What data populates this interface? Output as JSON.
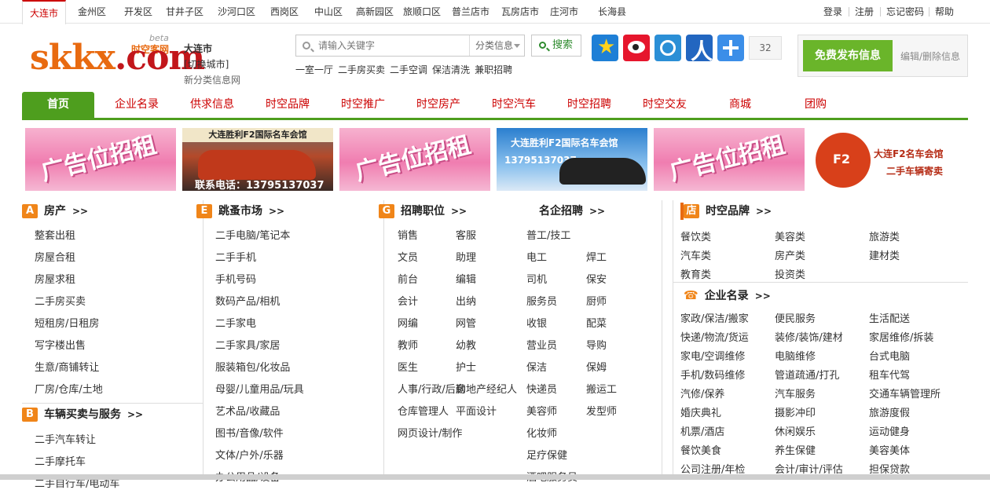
{
  "topbar": {
    "cities": [
      "大连市",
      "金州区",
      "开发区",
      "甘井子区",
      "沙河口区",
      "西岗区",
      "中山区",
      "高新园区",
      "旅顺口区",
      "普兰店市",
      "瓦房店市",
      "庄河市",
      "长海县"
    ],
    "account": [
      "登录",
      "注册",
      "忘记密码",
      "帮助"
    ]
  },
  "logo": {
    "main": "skkx",
    "dotcom": ".com",
    "beta": "beta",
    "brand": "时空客网"
  },
  "citybox": {
    "name": "大连市",
    "switch": "[切换城市]",
    "sub": "新分类信息网"
  },
  "search": {
    "placeholder": "请输入关键字",
    "category": "分类信息",
    "button": "搜索"
  },
  "hotwords": [
    "一室一厅",
    "二手房买卖",
    "二手空调",
    "保洁清洗",
    "兼职招聘"
  ],
  "social": [
    {
      "icon": "star-icon",
      "color": "#1e7fd6"
    },
    {
      "icon": "weibo-icon",
      "color": "#e6162d"
    },
    {
      "icon": "tencent-weibo-icon",
      "color": "#2b8fd6"
    },
    {
      "icon": "renren-icon",
      "color": "#2266c0"
    },
    {
      "icon": "plus-share-icon",
      "color": "#3b8ee8"
    }
  ],
  "share_count": "32",
  "post": {
    "button": "免费发布信息",
    "edit": "编辑/删除信息"
  },
  "nav": [
    "首页",
    "企业名录",
    "供求信息",
    "时空品牌",
    "时空推广",
    "时空房产",
    "时空汽车",
    "时空招聘",
    "时空交友",
    "商城",
    "团购"
  ],
  "banners": {
    "ad": "广告位招租",
    "car1_title": "大连胜利F2国际名车会馆",
    "car1_phone": "联系电话：13795137037",
    "car2_title": "大连胜利F2国际名车会馆",
    "car2_phone": "13795137037",
    "f2_title": "大连F2名车会馆",
    "f2_sub": "二手车辆寄卖"
  },
  "sections": {
    "house": {
      "letter": "A",
      "title": "房产",
      "arrow": ">>",
      "items": [
        "整套出租",
        "房屋合租",
        "房屋求租",
        "二手房买卖",
        "短租房/日租房",
        "写字楼出售",
        "生意/商铺转让",
        "厂房/仓库/土地"
      ]
    },
    "vehicle": {
      "letter": "B",
      "title": "车辆买卖与服务",
      "arrow": ">>",
      "items": [
        "二手汽车转让",
        "二手摩托车",
        "二手自行车/电动车"
      ]
    },
    "market": {
      "letter": "E",
      "title": "跳蚤市场",
      "arrow": ">>",
      "items": [
        "二手电脑/笔记本",
        "二手手机",
        "手机号码",
        "数码产品/相机",
        "二手家电",
        "二手家具/家居",
        "服装箱包/化妆品",
        "母婴/儿童用品/玩具",
        "艺术品/收藏品",
        "图书/音像/软件",
        "文体/户外/乐器",
        "办公用品/设备"
      ]
    },
    "jobs": {
      "letter": "G",
      "title": "招聘职位",
      "arrow": ">>",
      "items": [
        "销售",
        "客服",
        "文员",
        "助理",
        "前台",
        "编辑",
        "会计",
        "出纳",
        "网编",
        "网管",
        "教师",
        "幼教",
        "医生",
        "护士",
        "人事/行政/后勤",
        "房地产经纪人",
        "仓库管理人",
        "平面设计",
        "网页设计/制作"
      ]
    },
    "famous": {
      "title": "名企招聘",
      "arrow": ">>",
      "items": [
        "普工/技工",
        "电工",
        "焊工",
        "司机",
        "保安",
        "服务员",
        "厨师",
        "收银",
        "配菜",
        "营业员",
        "导购",
        "保洁",
        "保姆",
        "快递员",
        "搬运工",
        "美容师",
        "发型师",
        "化妆师",
        "足疗保健",
        "酒吧服务员"
      ]
    },
    "brand": {
      "icon": "店",
      "title": "时空品牌",
      "arrow": ">>",
      "items": [
        "餐饮类",
        "美容类",
        "旅游类",
        "汽车类",
        "房产类",
        "建材类",
        "教育类",
        "投资类"
      ]
    },
    "directory": {
      "title": "企业名录",
      "arrow": ">>",
      "items": [
        "家政/保洁/搬家",
        "便民服务",
        "生活配送",
        "快递/物流/货运",
        "装修/装饰/建材",
        "家居维修/拆装",
        "家电/空调维修",
        "电脑维修",
        "台式电脑",
        "手机/数码维修",
        "管道疏通/打孔",
        "租车代驾",
        "汽修/保养",
        "汽车服务",
        "交通车辆管理所",
        "婚庆典礼",
        "摄影冲印",
        "旅游度假",
        "机票/酒店",
        "休闲娱乐",
        "运动健身",
        "餐饮美食",
        "养生保健",
        "美容美体",
        "公司注册/年检",
        "会计/审计/评估",
        "担保贷款"
      ]
    }
  }
}
